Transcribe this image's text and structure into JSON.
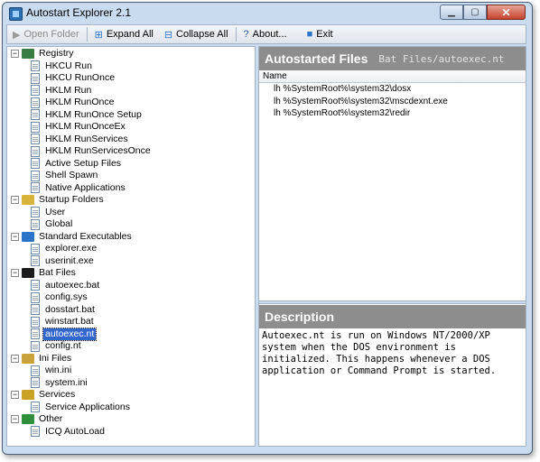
{
  "window": {
    "title": "Autostart Explorer 2.1"
  },
  "titlebar_buttons": {
    "minimize": "▁",
    "maximize": "▢",
    "close": "✕"
  },
  "toolbar": {
    "open_folder": "Open Folder",
    "expand_all": "Expand All",
    "collapse_all": "Collapse All",
    "about": "About...",
    "exit": "Exit"
  },
  "tree": [
    {
      "label": "Registry",
      "expander": "−",
      "icon": "registry-icon",
      "color": "#3a7d44",
      "children": [
        "HKCU Run",
        "HKCU RunOnce",
        "HKLM Run",
        "HKLM RunOnce",
        "HKLM RunOnce Setup",
        "HKLM RunOnceEx",
        "HKLM RunServices",
        "HKLM RunServicesOnce",
        "Active Setup Files",
        "Shell Spawn",
        "Native Applications"
      ]
    },
    {
      "label": "Startup Folders",
      "expander": "−",
      "icon": "folder-icon",
      "color": "#d9b43b",
      "children": [
        "User",
        "Global"
      ]
    },
    {
      "label": "Standard Executables",
      "expander": "−",
      "icon": "window-icon",
      "color": "#2b74c7",
      "children": [
        "explorer.exe",
        "userinit.exe"
      ]
    },
    {
      "label": "Bat Files",
      "expander": "−",
      "icon": "console-icon",
      "color": "#1c1c1c",
      "children": [
        "autoexec.bat",
        "config.sys",
        "dosstart.bat",
        "winstart.bat",
        "autoexec.nt",
        "config.nt"
      ]
    },
    {
      "label": "Ini Files",
      "expander": "−",
      "icon": "ini-icon",
      "color": "#caa23a",
      "children": [
        "win.ini",
        "system.ini"
      ]
    },
    {
      "label": "Services",
      "expander": "−",
      "icon": "services-icon",
      "color": "#c9a125",
      "children": [
        "Service Applications"
      ]
    },
    {
      "label": "Other",
      "expander": "−",
      "icon": "other-icon",
      "color": "#2f8f3a",
      "children": [
        "ICQ AutoLoad"
      ]
    }
  ],
  "selected": "autoexec.nt",
  "files_panel": {
    "title": "Autostarted Files",
    "subtitle": "Bat Files/autoexec.nt",
    "column": "Name",
    "rows": [
      "lh %SystemRoot%\\system32\\dosx",
      "lh %SystemRoot%\\system32\\mscdexnt.exe",
      "lh %SystemRoot%\\system32\\redir"
    ]
  },
  "description_panel": {
    "title": "Description",
    "text": "Autoexec.nt is run on Windows NT/2000/XP system when the DOS environment is initialized. This happens whenever a DOS application or Command Prompt is started."
  }
}
